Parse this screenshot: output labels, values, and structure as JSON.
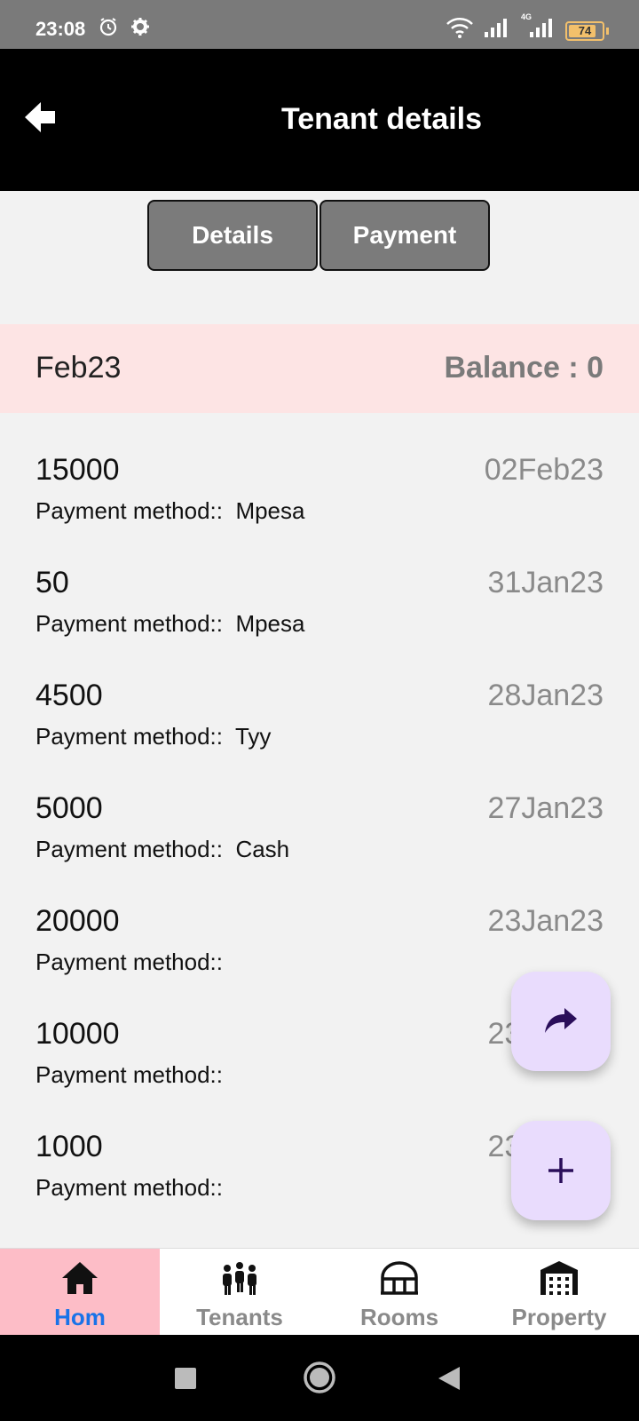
{
  "status_bar": {
    "time": "23:08",
    "battery": "74",
    "network_label": "4G",
    "icons": [
      "alarm-icon",
      "gear-icon",
      "wifi-icon",
      "signal-icon",
      "signal-4g-icon",
      "battery-icon"
    ]
  },
  "app_bar": {
    "title": "Tenant details",
    "back_icon": "back-arrow-icon"
  },
  "segments": {
    "details_label": "Details",
    "payment_label": "Payment"
  },
  "month": {
    "label": "Feb23",
    "balance": "Balance : 0"
  },
  "payments": [
    {
      "amount": "15000",
      "method": "Payment method::  Mpesa",
      "date": "02Feb23"
    },
    {
      "amount": "50",
      "method": "Payment method::  Mpesa",
      "date": "31Jan23"
    },
    {
      "amount": "4500",
      "method": "Payment method::  Tyy",
      "date": "28Jan23"
    },
    {
      "amount": "5000",
      "method": "Payment method::  Cash",
      "date": "27Jan23"
    },
    {
      "amount": "20000",
      "method": "Payment method::",
      "date": "23Jan23"
    },
    {
      "amount": "10000",
      "method": "Payment method::",
      "date": "23Jan23"
    },
    {
      "amount": "1000",
      "method": "Payment method::",
      "date": "23Jan23"
    }
  ],
  "fabs": {
    "share_icon": "share-icon",
    "add_icon": "add-icon"
  },
  "bottom_nav": [
    {
      "label": "Hom",
      "icon": "home-icon",
      "active": true
    },
    {
      "label": "Tenants",
      "icon": "people-icon",
      "active": false
    },
    {
      "label": "Rooms",
      "icon": "rooms-icon",
      "active": false
    },
    {
      "label": "Property",
      "icon": "building-icon",
      "active": false
    }
  ],
  "colors": {
    "app_bar": "#000000",
    "month_row": "#fde4e4",
    "fab": "#e9dcfd",
    "nav_active_bg": "#fdbdc7",
    "nav_active_text": "#1a73e8"
  }
}
